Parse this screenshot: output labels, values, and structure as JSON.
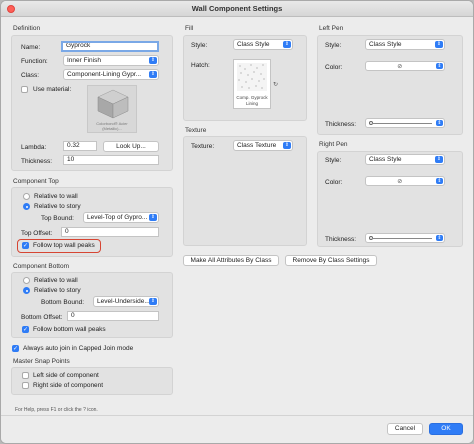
{
  "window": {
    "title": "Wall Component Settings"
  },
  "definition": {
    "section": "Definition",
    "name_label": "Name:",
    "name_value": "Gyprock",
    "function_label": "Function:",
    "function_value": "Inner Finish",
    "class_label": "Class:",
    "class_value": "Component-Lining Gypr...",
    "use_material_label": "Use material:",
    "material_caption": "Colorbond® Acier (Metallic)...",
    "lambda_label": "Lambda:",
    "lambda_value": "0.32",
    "lookup_label": "Look Up...",
    "thickness_label": "Thickness:",
    "thickness_value": "10"
  },
  "fill": {
    "section": "Fill",
    "style_label": "Style:",
    "style_value": "Class Style",
    "hatch_label": "Hatch:",
    "hatch_caption": "Comp. Gyprock Lining"
  },
  "texture": {
    "section": "Texture",
    "texture_label": "Texture:",
    "texture_value": "Class Texture"
  },
  "left_pen": {
    "section": "Left Pen",
    "style_label": "Style:",
    "style_value": "Class Style",
    "color_label": "Color:",
    "thickness_label": "Thickness:"
  },
  "right_pen": {
    "section": "Right Pen",
    "style_label": "Style:",
    "style_value": "Class Style",
    "color_label": "Color:",
    "thickness_label": "Thickness:"
  },
  "actions": {
    "make_all_label": "Make All Attributes By Class",
    "remove_label": "Remove By Class Settings"
  },
  "component_top": {
    "section": "Component Top",
    "relative_wall_label": "Relative to wall",
    "relative_story_label": "Relative to story",
    "top_bound_label": "Top Bound:",
    "top_bound_value": "Level-Top of Gypro...",
    "top_offset_label": "Top Offset:",
    "top_offset_value": "0",
    "follow_peaks_label": "Follow top wall peaks"
  },
  "component_bottom": {
    "section": "Component Bottom",
    "relative_wall_label": "Relative to wall",
    "relative_story_label": "Relative to story",
    "bottom_bound_label": "Bottom Bound:",
    "bottom_bound_value": "Level-Underside...",
    "bottom_offset_label": "Bottom Offset:",
    "bottom_offset_value": "0",
    "follow_bottom_label": "Follow bottom wall peaks"
  },
  "auto_join_label": "Always auto join in Capped Join mode",
  "master_snap": {
    "section": "Master Snap Points",
    "left_side_label": "Left side of component",
    "right_side_label": "Right side of component"
  },
  "footer": {
    "help_text": "For Help, press F1 or click the ? icon.",
    "cancel_label": "Cancel",
    "ok_label": "OK"
  },
  "colors": {
    "accent": "#2f7cf6",
    "highlight": "#d64533"
  }
}
